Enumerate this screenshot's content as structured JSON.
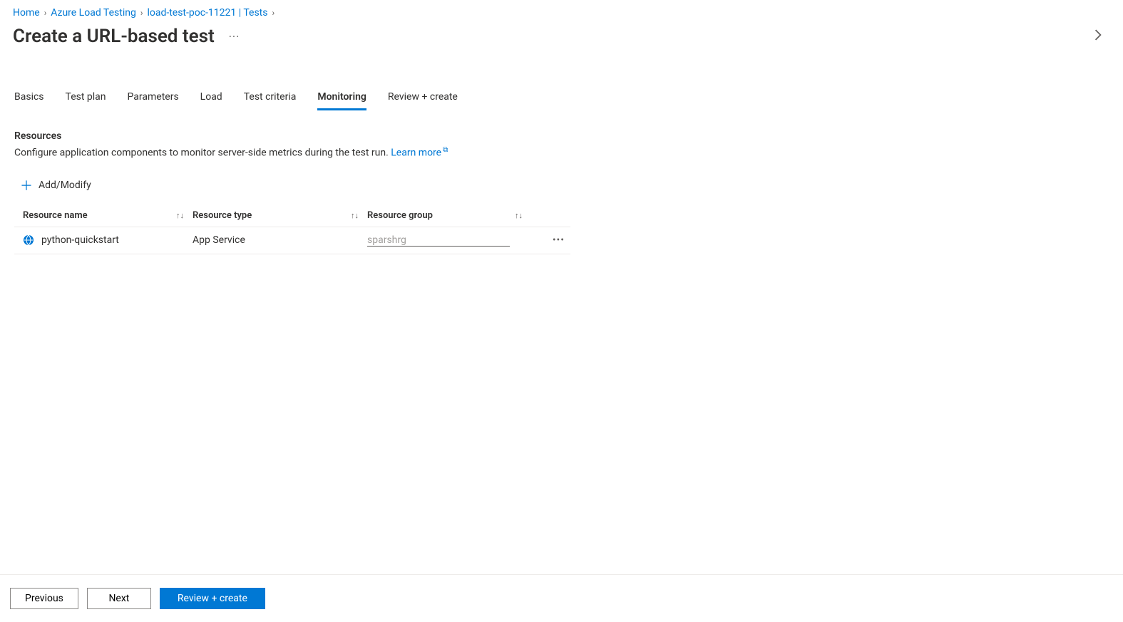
{
  "breadcrumb": {
    "items": [
      "Home",
      "Azure Load Testing",
      "load-test-poc-11221 | Tests"
    ]
  },
  "page": {
    "title": "Create a URL-based test"
  },
  "tabs": {
    "items": [
      "Basics",
      "Test plan",
      "Parameters",
      "Load",
      "Test criteria",
      "Monitoring",
      "Review + create"
    ],
    "active": "Monitoring"
  },
  "section": {
    "heading": "Resources",
    "description": "Configure application components to monitor server-side metrics during the test run. ",
    "learn_more": "Learn more"
  },
  "toolbar": {
    "add_modify": "Add/Modify"
  },
  "table": {
    "columns": {
      "name": "Resource name",
      "type": "Resource type",
      "group": "Resource group"
    },
    "rows": [
      {
        "name": "python-quickstart",
        "type": "App Service",
        "group": "sparshrg"
      }
    ]
  },
  "footer": {
    "previous": "Previous",
    "next": "Next",
    "review_create": "Review + create"
  }
}
